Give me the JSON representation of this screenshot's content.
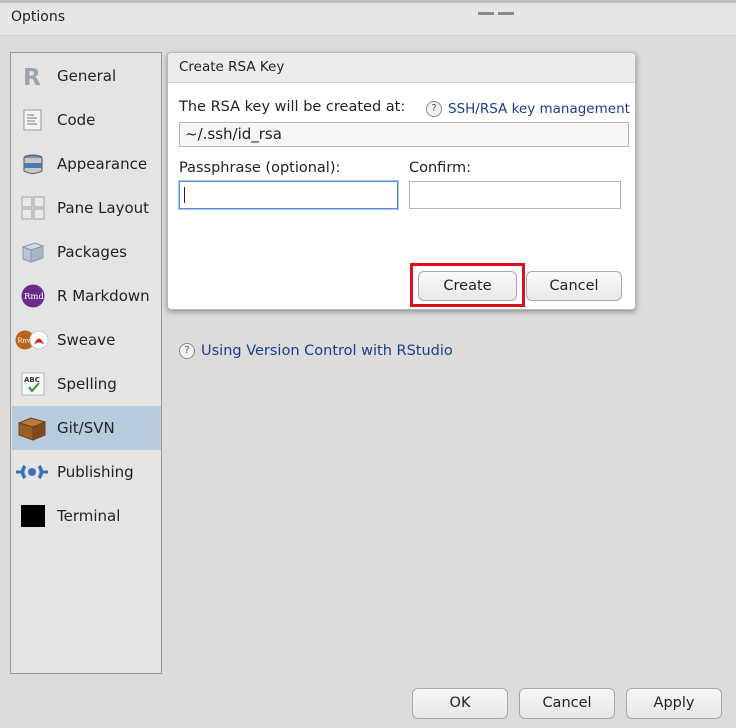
{
  "window": {
    "title": "Options"
  },
  "sidebar": {
    "items": [
      {
        "label": "General",
        "icon": "r-logo-icon"
      },
      {
        "label": "Code",
        "icon": "code-document-icon"
      },
      {
        "label": "Appearance",
        "icon": "paint-bucket-icon"
      },
      {
        "label": "Pane Layout",
        "icon": "pane-layout-icon"
      },
      {
        "label": "Packages",
        "icon": "package-box-icon"
      },
      {
        "label": "R Markdown",
        "icon": "rmd-icon"
      },
      {
        "label": "Sweave",
        "icon": "sweave-icon"
      },
      {
        "label": "Spelling",
        "icon": "spelling-abc-icon"
      },
      {
        "label": "Git/SVN",
        "icon": "git-box-icon",
        "selected": true
      },
      {
        "label": "Publishing",
        "icon": "publishing-icon"
      },
      {
        "label": "Terminal",
        "icon": "terminal-icon"
      }
    ]
  },
  "content": {
    "help_link": "Using Version Control with RStudio"
  },
  "dialog": {
    "title": "Create RSA Key",
    "rsa_label": "The RSA key will be created at:",
    "ssh_link": "SSH/RSA key management",
    "path": "~/.ssh/id_rsa",
    "passphrase_label": "Passphrase (optional):",
    "passphrase_value": "",
    "confirm_label": "Confirm:",
    "confirm_value": "",
    "create_label": "Create",
    "cancel_label": "Cancel",
    "highlight_color": "#d8111f"
  },
  "footer": {
    "ok_label": "OK",
    "cancel_label": "Cancel",
    "apply_label": "Apply"
  },
  "colors": {
    "selected_bg": "#b9ccdd",
    "link": "#1a3d8f"
  }
}
